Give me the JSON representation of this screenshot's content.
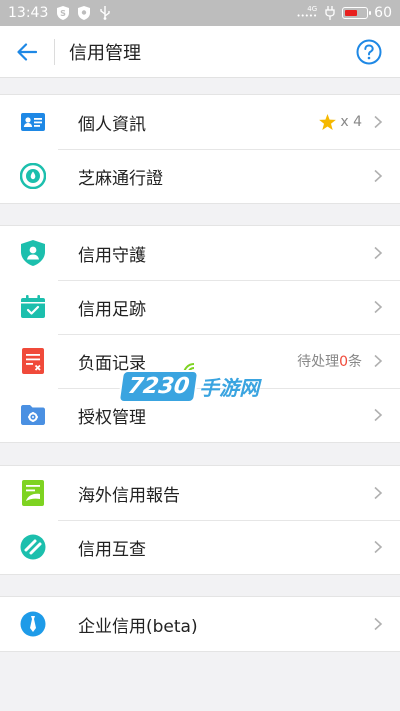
{
  "status_bar": {
    "time": "13:43",
    "network_top": "4G",
    "network_bottom": "•••••",
    "battery_text": "60",
    "battery_level": 0.6
  },
  "header": {
    "title": "信用管理",
    "back_icon": "arrow-left-icon",
    "help_icon": "question-circle-icon"
  },
  "colors": {
    "accent": "#1e88e5",
    "teal": "#1cbfad",
    "red": "#f04a3a",
    "green": "#7ed321",
    "watermark": "#3aa4e0"
  },
  "groups": [
    {
      "items": [
        {
          "label": "個人資訊",
          "icon": "id-card-icon",
          "star_icon": "star-icon",
          "star_count": "x 4"
        },
        {
          "label": "芝麻通行證",
          "icon": "sesame-pass-icon"
        }
      ]
    },
    {
      "items": [
        {
          "label": "信用守護",
          "icon": "shield-user-icon"
        },
        {
          "label": "信用足跡",
          "icon": "calendar-check-icon"
        },
        {
          "label": "负面记录",
          "icon": "negative-record-icon",
          "pending_prefix": "待处理",
          "pending_count": "0",
          "pending_suffix": "条"
        },
        {
          "label": "授权管理",
          "icon": "folder-gear-icon"
        }
      ]
    },
    {
      "items": [
        {
          "label": "海外信用報告",
          "icon": "overseas-report-icon"
        },
        {
          "label": "信用互查",
          "icon": "mutual-check-icon"
        }
      ]
    },
    {
      "items": [
        {
          "label": "企业信用(beta)",
          "icon": "enterprise-tie-icon"
        }
      ]
    }
  ],
  "watermark": {
    "badge": "7230",
    "text": "手游网"
  }
}
